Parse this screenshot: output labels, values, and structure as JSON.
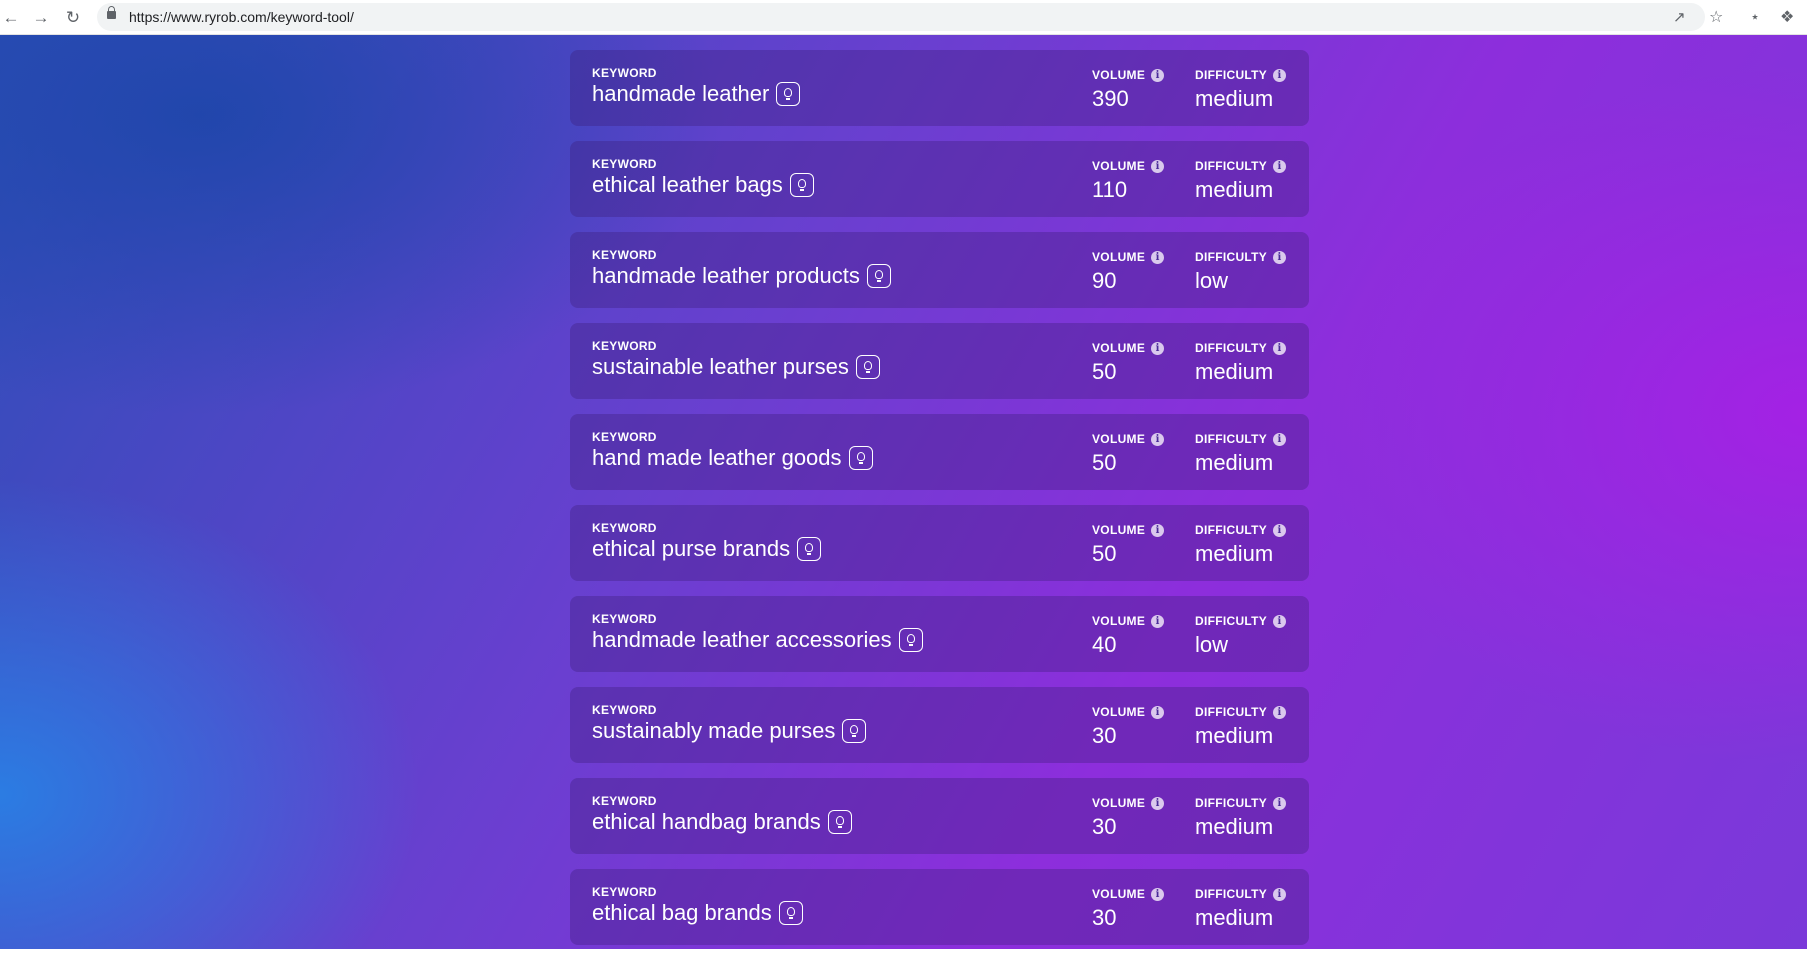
{
  "browser": {
    "url": "https://www.ryrob.com/keyword-tool/",
    "icons": [
      "back-icon",
      "forward-icon",
      "reload-icon",
      "lock-icon",
      "share-icon",
      "star-icon",
      "extension-vscode-icon",
      "puzzle-icon"
    ]
  },
  "labels": {
    "keyword": "KEYWORD",
    "volume": "VOLUME",
    "difficulty": "DIFFICULTY",
    "info": "i"
  },
  "keywords": [
    {
      "keyword": "handmade leather",
      "volume": "390",
      "difficulty": "medium"
    },
    {
      "keyword": "ethical leather bags",
      "volume": "110",
      "difficulty": "medium"
    },
    {
      "keyword": "handmade leather products",
      "volume": "90",
      "difficulty": "low"
    },
    {
      "keyword": "sustainable leather purses",
      "volume": "50",
      "difficulty": "medium"
    },
    {
      "keyword": "hand made leather goods",
      "volume": "50",
      "difficulty": "medium"
    },
    {
      "keyword": "ethical purse brands",
      "volume": "50",
      "difficulty": "medium"
    },
    {
      "keyword": "handmade leather accessories",
      "volume": "40",
      "difficulty": "low"
    },
    {
      "keyword": "sustainably made purses",
      "volume": "30",
      "difficulty": "medium"
    },
    {
      "keyword": "ethical handbag brands",
      "volume": "30",
      "difficulty": "medium"
    },
    {
      "keyword": "ethical bag brands",
      "volume": "30",
      "difficulty": "medium"
    }
  ]
}
